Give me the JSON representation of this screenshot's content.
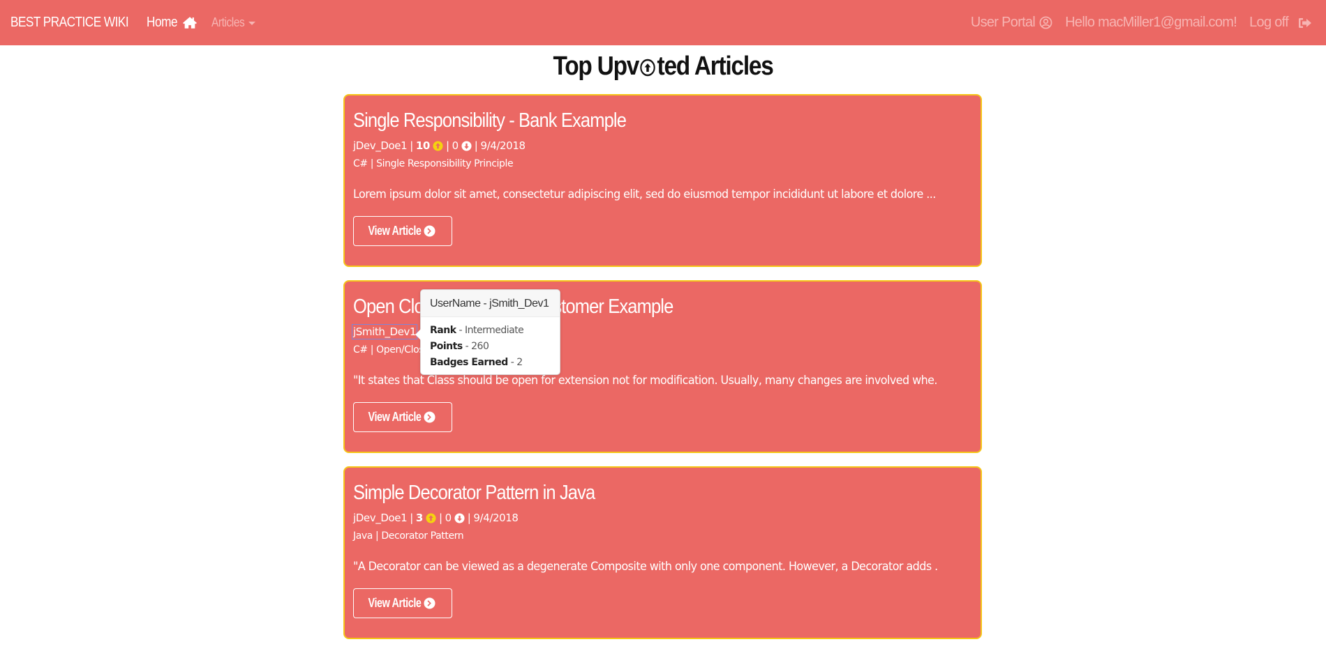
{
  "navbar": {
    "brand": "BEST PRACTICE WIKI",
    "home_label": "Home",
    "home_icon": "home-icon",
    "articles_label": "Articles",
    "user_portal_label": "User Portal",
    "user_portal_icon": "user-circle-icon",
    "greeting": "Hello macMiller1@gmail.com!",
    "logoff_label": "Log off",
    "logoff_icon": "sign-out-icon"
  },
  "colors": {
    "primary": "#eb6864",
    "card_border": "#f5c518",
    "upvote": "#f5d30f",
    "text_light": "#ffffff",
    "nav_muted": "#f7b4b2"
  },
  "page": {
    "title_part1": "Top Upv",
    "title_icon": "arrow-circle-up-icon",
    "title_part2": "ted Articles"
  },
  "articles": [
    {
      "title": "Single Responsibility - Bank Example",
      "author": "jDev_Doe1",
      "upvotes": "10",
      "downvotes": "0",
      "date": "9/4/2018",
      "language": "C#",
      "category": "Single Responsibility Principle",
      "excerpt": "Lorem ipsum dolor sit amet, consectetur adipiscing elit, sed do eiusmod tempor incididunt ut labore et dolore ...",
      "button_label": "View Article"
    },
    {
      "title": "Open Closed Principle - Customer Example",
      "author": "jSmith_Dev1",
      "upvotes": "",
      "downvotes": "",
      "date": "",
      "language": "C#",
      "category": "Open/Closed Principle",
      "excerpt": "\"It states that Class should be open for extension not for modification. Usually, many changes are involved whe...",
      "button_label": "View Article"
    },
    {
      "title": "Simple Decorator Pattern in Java",
      "author": "jDev_Doe1",
      "upvotes": "3",
      "downvotes": "0",
      "date": "9/4/2018",
      "language": "Java",
      "category": "Decorator Pattern",
      "excerpt": "\"A Decorator can be viewed as a degenerate Composite with only one component. However, a Decorator adds ...",
      "button_label": "View Article"
    }
  ],
  "tooltip": {
    "header": "UserName - jSmith_Dev1",
    "rows": [
      {
        "label": "Rank",
        "value": " - Intermediate"
      },
      {
        "label": "Points",
        "value": " - 260"
      },
      {
        "label": "Badges Earned",
        "value": " - 2"
      }
    ]
  }
}
